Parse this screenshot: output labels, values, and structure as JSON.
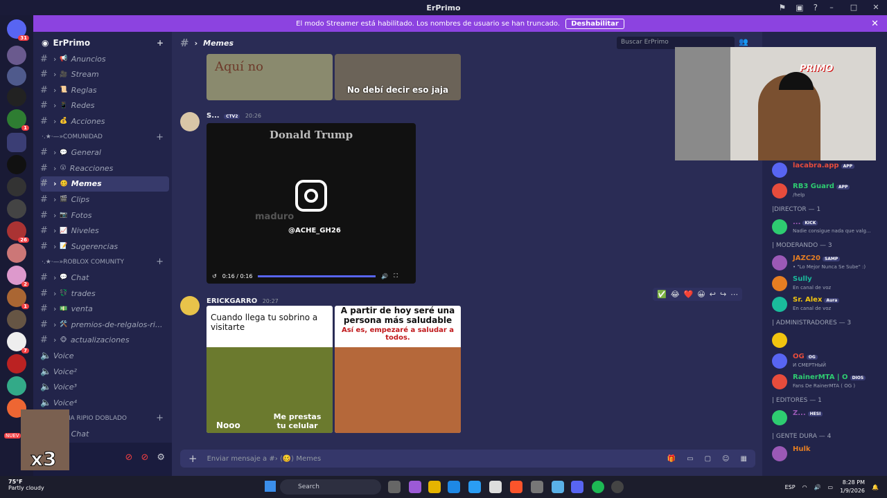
{
  "window": {
    "title": "ErPrimo",
    "controls": [
      "–",
      "□",
      "✕"
    ]
  },
  "banner": {
    "text": "El modo Streamer está habilitado. Los nombres de usuario se han truncado.",
    "button": "Deshabilitar"
  },
  "guilds": {
    "badges": [
      "31",
      "1",
      "26",
      "2",
      "1",
      "7"
    ],
    "new_label": "NUEV"
  },
  "server": {
    "name": "ErPrimo"
  },
  "channels": {
    "top": [
      {
        "name": "Anuncios",
        "emoji": "📢"
      },
      {
        "name": "Stream",
        "emoji": "🎥"
      },
      {
        "name": "Reglas",
        "emoji": "📜"
      },
      {
        "name": "Redes",
        "emoji": "📱"
      },
      {
        "name": "Acciones",
        "emoji": "💰"
      }
    ],
    "cat_comunidad": "·.★·—»COMUNIDAD",
    "comunidad": [
      {
        "name": "General",
        "emoji": "💬"
      },
      {
        "name": "Reacciones",
        "emoji": "😮"
      },
      {
        "name": "Memes",
        "emoji": "🥴",
        "active": true
      },
      {
        "name": "Clips",
        "emoji": "🎬"
      },
      {
        "name": "Fotos",
        "emoji": "📷"
      },
      {
        "name": "Niveles",
        "emoji": "📈"
      },
      {
        "name": "Sugerencias",
        "emoji": "📝"
      }
    ],
    "cat_roblox": "·.★·—»ROBLOX COMUNITY",
    "roblox": [
      {
        "name": "Chat",
        "emoji": "💬"
      },
      {
        "name": "trades",
        "emoji": "💱"
      },
      {
        "name": "venta",
        "emoji": "💵"
      },
      {
        "name": "premios-de-relgalos-ri...",
        "emoji": "🛠️"
      },
      {
        "name": "actualizaciones",
        "emoji": "🐵"
      }
    ],
    "voice": [
      "Voice",
      "Voice²",
      "Voice³",
      "Voice⁴"
    ],
    "cat_academia": "ACADEMIA RIPIO DOBLADO",
    "academia": [
      {
        "name": "Chat",
        "emoji": "💬"
      }
    ]
  },
  "header": {
    "channel": "Memes",
    "search_placeholder": "Buscar ErPrimo"
  },
  "messages": [
    {
      "meme_caption": "No debí decir eso jaja",
      "top_text": "Aquí no"
    },
    {
      "user": "S...",
      "tag": "CTV2",
      "time": "20:26",
      "video": {
        "title": "Donald Trump",
        "handle": "@ACHE_GH26",
        "overlay": "maduro",
        "time": "0:16 / 0:16"
      }
    },
    {
      "user": "ERICKGARRO",
      "time": "20:27",
      "meme_left": {
        "top": "Cuando llega tu sobrino a visitarte",
        "b1": "Nooo",
        "b2": "Me prestas tu celular"
      },
      "meme_right": {
        "top": "A partir de hoy seré una persona más saludable",
        "sub": "Así es, empezaré a saludar a todos."
      }
    }
  ],
  "reactions": [
    "✅",
    "😂",
    "❤️",
    "😀",
    "↩",
    "↪",
    "⋯"
  ],
  "composer": {
    "placeholder": "Enviar mensaje a #› ⟨🥴⟩ Memes"
  },
  "members": {
    "top": [
      {
        "name": "lacabra.app",
        "status": "",
        "tag": "APP"
      },
      {
        "name": "RB3 Guard",
        "status": "/help",
        "tag": "APP"
      }
    ],
    "sections": [
      {
        "title": "|DIRECTOR — 1",
        "users": [
          {
            "name": "...",
            "status": "Nadie consigue nada que valg...",
            "tag": "KICK"
          }
        ]
      },
      {
        "title": "| MODERANDO — 3",
        "users": [
          {
            "name": "JAZC20",
            "status": "• \"Lo Mejor Nunca Se Sube\" :)",
            "tag": "SAMP"
          },
          {
            "name": "Sully",
            "status": "En canal de voz",
            "tag": ""
          },
          {
            "name": "Sr. Alex",
            "status": "En canal de voz",
            "tag": "Aura"
          }
        ]
      },
      {
        "title": "| ADMINISTRADORES — 3",
        "users": [
          {
            "name": "",
            "status": "",
            "tag": ""
          },
          {
            "name": "OG",
            "status": "И СМЕРТНЫЙ",
            "tag": "OG"
          },
          {
            "name": "RainerMTA | O",
            "status": "Fans De RainerMTA ( OG )",
            "tag": "DIOS"
          }
        ]
      },
      {
        "title": "| EDITORES — 1",
        "users": [
          {
            "name": "Z...",
            "status": "",
            "tag": "HESI"
          }
        ]
      },
      {
        "title": "| GENTE DURA — 4",
        "users": [
          {
            "name": "Hulk",
            "status": "",
            "tag": ""
          }
        ]
      }
    ]
  },
  "webcam": {
    "label": "PRIMO"
  },
  "overlay": {
    "multiplier": "x3"
  },
  "taskbar": {
    "weather_temp": "75°F",
    "weather_desc": "Partly cloudy",
    "search": "Search",
    "lang": "ESP",
    "time": "8:28 PM",
    "date": "1/9/2026"
  }
}
